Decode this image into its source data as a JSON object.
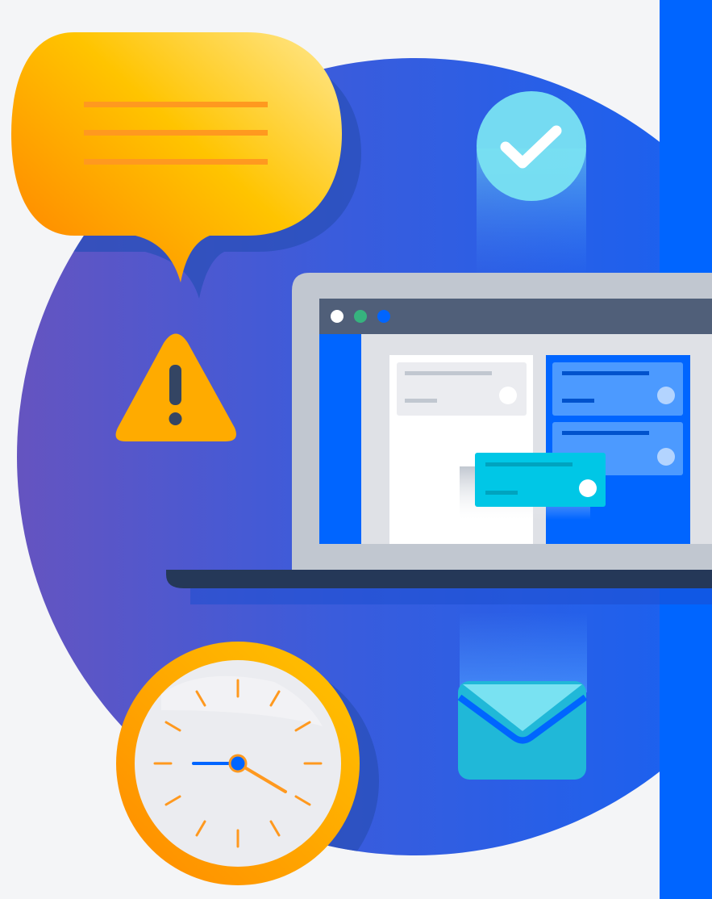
{
  "illustration": {
    "colors": {
      "background": "#f4f5f7",
      "circle_gradient_start": "#6554c0",
      "circle_gradient_mid": "#2d5ce0",
      "circle_gradient_end": "#1063f6",
      "right_band": "#0065ff",
      "bubble_light": "#ffe27a",
      "bubble_mid": "#ffc400",
      "bubble_dark": "#ff8b00",
      "bubble_lines": "#ff991f",
      "warning": "#ffab00",
      "warning_mark": "#344563",
      "check_circle": "#79e2f2",
      "laptop_frame": "#c1c7d0",
      "laptop_base": "#253858",
      "window_titlebar": "#505f79",
      "dot_white": "#ffffff",
      "dot_green": "#36b37e",
      "dot_blue": "#0065ff",
      "kanban_column_blue": "#0065ff",
      "kanban_card_blue": "#4c9aff",
      "dragged_card": "#00c7e6",
      "envelope": "#20b8d8",
      "envelope_flap": "#0065ff",
      "clock_ring": "#ff991f",
      "clock_face": "#ebecf0",
      "clock_ticks": "#ff991f",
      "clock_hand_hour": "#0065ff",
      "clock_hand_minute": "#ff991f"
    },
    "icons": [
      "speech-bubble-icon",
      "warning-icon",
      "checkmark-icon",
      "laptop-icon",
      "kanban-board",
      "envelope-icon",
      "clock-icon"
    ]
  }
}
